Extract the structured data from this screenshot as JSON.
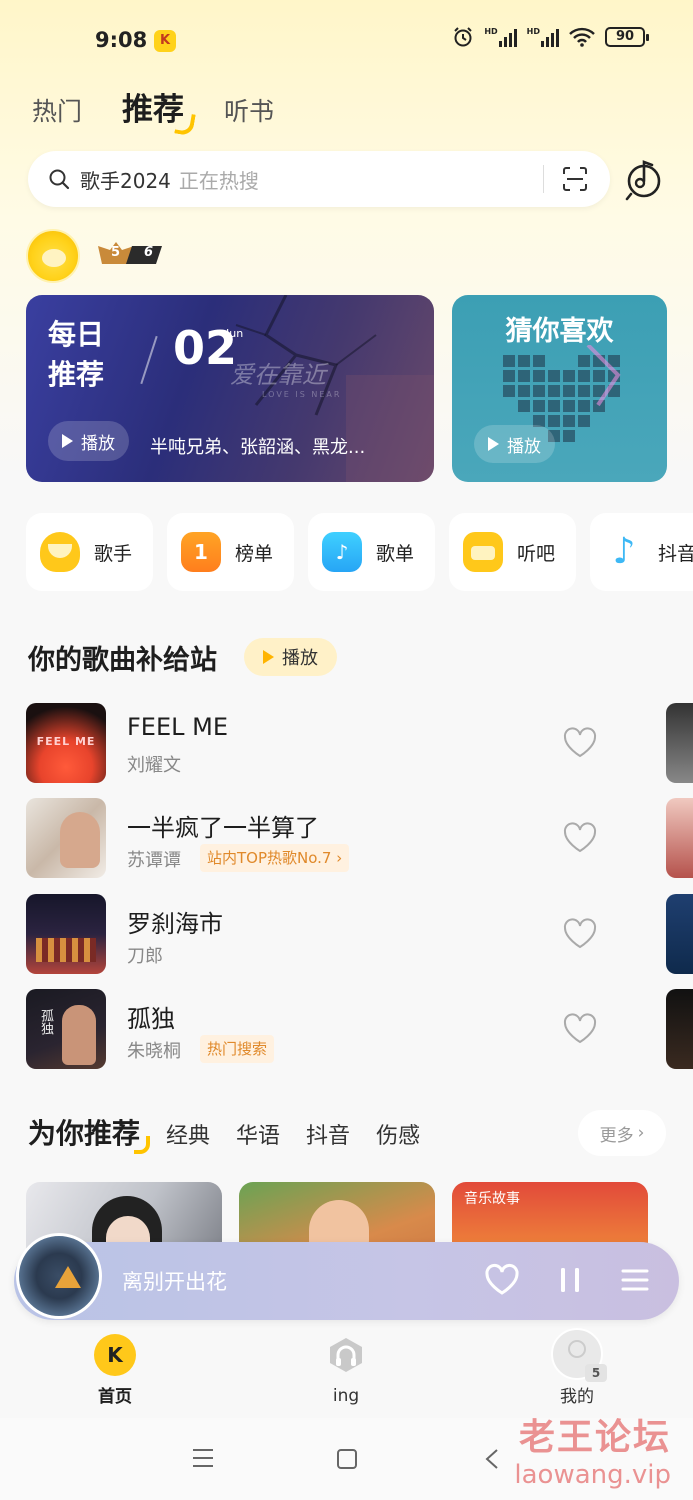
{
  "status_bar": {
    "time": "9:08",
    "network_a": "HD",
    "network_b": "HD",
    "battery": "90"
  },
  "tabs": [
    {
      "label": "热门"
    },
    {
      "label": "推荐"
    },
    {
      "label": "听书"
    }
  ],
  "search": {
    "query": "歌手2024",
    "hint": "正在热搜"
  },
  "user": {
    "level_main": "5",
    "level_sub": "6"
  },
  "daily_card": {
    "title_line1": "每日",
    "title_line2": "推荐",
    "day": "02",
    "month": "Jun",
    "art_text": "爱在靠近",
    "art_sub": "LOVE IS NEAR",
    "play_label": "播放",
    "artists": "半吨兄弟、张韶涵、黑龙..."
  },
  "guess_card": {
    "title": "猜你喜欢",
    "play_label": "播放"
  },
  "entries": [
    {
      "label": "歌手"
    },
    {
      "label": "榜单"
    },
    {
      "label": "歌单"
    },
    {
      "label": "听吧"
    },
    {
      "label": "抖音"
    }
  ],
  "supply_section": {
    "title": "你的歌曲补给站",
    "play_label": "播放"
  },
  "songs": [
    {
      "name": "FEEL ME",
      "artist": "刘耀文",
      "tag": "",
      "cover_text": "FEEL ME"
    },
    {
      "name": "一半疯了一半算了",
      "artist": "苏谭谭",
      "tag": "站内TOP热歌No.7",
      "cover_text": ""
    },
    {
      "name": "罗刹海市",
      "artist": "刀郎",
      "tag": "",
      "cover_text": ""
    },
    {
      "name": "孤独",
      "artist": "朱晓桐",
      "tag": "热门搜索",
      "cover_text": "孤独"
    }
  ],
  "recommend": {
    "title": "为你推荐",
    "tabs": [
      {
        "label": "经典"
      },
      {
        "label": "华语"
      },
      {
        "label": "抖音"
      },
      {
        "label": "伤感"
      }
    ],
    "more_label": "更多",
    "story_label": "音乐故事"
  },
  "player": {
    "title": "离别开出花"
  },
  "nav": [
    {
      "label": "首页"
    },
    {
      "label": "ing"
    },
    {
      "label": "我的"
    }
  ],
  "nav_badge": "5",
  "watermark": {
    "line1": "老王论坛",
    "line2": "laowang.vip"
  },
  "colors": {
    "accent": "#ffc400",
    "daily_bg": "#2b2e7a",
    "guess_bg": "#3c9fb4",
    "tag_text": "#e0892a"
  }
}
